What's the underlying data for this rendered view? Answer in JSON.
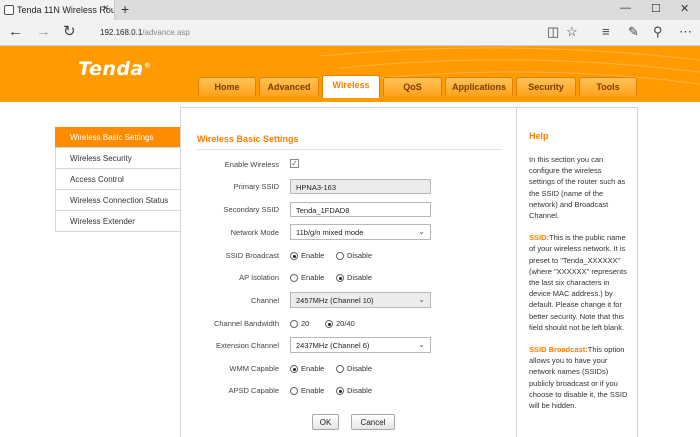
{
  "browser": {
    "tab_title": "Tenda 11N Wireless Rout",
    "tab_close": "×",
    "new_tab": "+",
    "address_host": "192.168.0.1",
    "address_path": "/advance.asp",
    "icons": [
      "back-icon",
      "forward-icon",
      "refresh-icon",
      "reading-view-icon",
      "favorite-star-icon",
      "hub-icon",
      "web-note-icon",
      "share-icon",
      "more-icon"
    ]
  },
  "header": {
    "logo": "Tenda",
    "logo_mark": "®",
    "tabs": [
      {
        "label": "Home"
      },
      {
        "label": "Advanced"
      },
      {
        "label": "Wireless"
      },
      {
        "label": "QoS"
      },
      {
        "label": "Applications"
      },
      {
        "label": "Security"
      },
      {
        "label": "Tools"
      }
    ],
    "active_tab": "Wireless",
    "colors": {
      "brand_orange": "#ff9a00",
      "accent_text": "#ff7e00"
    }
  },
  "sidebar": {
    "items": [
      {
        "label": "Wireless Basic Settings"
      },
      {
        "label": "Wireless Security"
      },
      {
        "label": "Access Control"
      },
      {
        "label": "Wireless Connection Status"
      },
      {
        "label": "Wireless Extender"
      }
    ],
    "active_index": 0
  },
  "form": {
    "title": "Wireless Basic Settings",
    "enable_wireless": {
      "label": "Enable Wireless",
      "checked": true,
      "mark": "✓"
    },
    "primary_ssid": {
      "label": "Primary SSID",
      "value": "HPNA3-163"
    },
    "secondary_ssid": {
      "label": "Secondary SSID",
      "value": "Tenda_1FDAD8"
    },
    "network_mode": {
      "label": "Network Mode",
      "value": "11b/g/n mixed mode"
    },
    "ssid_broadcast": {
      "label": "SSID Broadcast",
      "opt1": "Enable",
      "opt2": "Disable",
      "selected": "Enable"
    },
    "ap_isolation": {
      "label": "AP Isolation",
      "opt1": "Enable",
      "opt2": "Disable",
      "selected": "Disable"
    },
    "channel": {
      "label": "Channel",
      "value": "2457MHz (Channel 10)"
    },
    "channel_bandwidth": {
      "label": "Channel Bandwidth",
      "opt1": "20",
      "opt2": "20/40",
      "selected": "20/40"
    },
    "extension_channel": {
      "label": "Extension Channel",
      "value": "2437MHz (Channel 6)"
    },
    "wmm_capable": {
      "label": "WMM Capable",
      "opt1": "Enable",
      "opt2": "Disable",
      "selected": "Enable"
    },
    "apsd_capable": {
      "label": "APSD Capable",
      "opt1": "Enable",
      "opt2": "Disable",
      "selected": "Disable"
    },
    "ok_label": "OK",
    "cancel_label": "Cancel"
  },
  "help": {
    "title": "Help",
    "p1": "In this section you can configure the wireless settings of the router such as the SSID (name of the network) and Broadcast Channel.",
    "p2_term": "SSID:",
    "p2": "This is the public name of your wireless network. It is preset to \"Tenda_XXXXXX\" (where \"XXXXXX\" represents the last six characters in device MAC address.) by default. Please change it for better security. Note that this field should not be left blank.",
    "p3_term": "SSID Broadcast:",
    "p3": "This option allows you to have your network names (SSIDs) publicly broadcast or if you choose to disable it, the SSID will be hidden."
  }
}
